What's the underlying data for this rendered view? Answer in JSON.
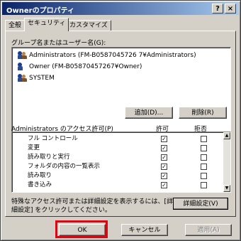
{
  "window": {
    "title": "Ownerのプロパティ",
    "help_btn": "?",
    "close_btn": "×"
  },
  "tabs": [
    "全般",
    "セキュリティ",
    "カスタマイズ"
  ],
  "groups_label": "グループ名またはユーザー名(G):",
  "users": [
    "Administrators (FM-B0587045726 7¥Administrators)",
    "Owner (FM-B05870457267¥Owner)",
    "SYSTEM"
  ],
  "buttons": {
    "add": "追加(D)...",
    "remove": "削除(R)",
    "advanced": "詳細設定(V)",
    "ok": "OK",
    "cancel": "キャンセル",
    "apply": "適用(A)"
  },
  "permissions_header": {
    "label": "Administrators のアクセス許可(P)",
    "allow": "許可",
    "deny": "拒否"
  },
  "permissions": [
    {
      "name": "フル コントロール",
      "allow": true,
      "deny": false
    },
    {
      "name": "変更",
      "allow": true,
      "deny": false
    },
    {
      "name": "読み取りと実行",
      "allow": true,
      "deny": false
    },
    {
      "name": "フォルダの内容の一覧表示",
      "allow": true,
      "deny": false
    },
    {
      "name": "読み取り",
      "allow": true,
      "deny": false
    },
    {
      "name": "書き込み",
      "allow": true,
      "deny": false
    }
  ],
  "info_text_1": "特殊なアクセス許可または詳細設定を表示するには、[詳",
  "info_text_2": "細設定] をクリックしてください。",
  "colors": {
    "title_start": "#0a246a",
    "title_end": "#a6caf0",
    "highlight": "#e8000c",
    "face": "#d4d0c8"
  }
}
